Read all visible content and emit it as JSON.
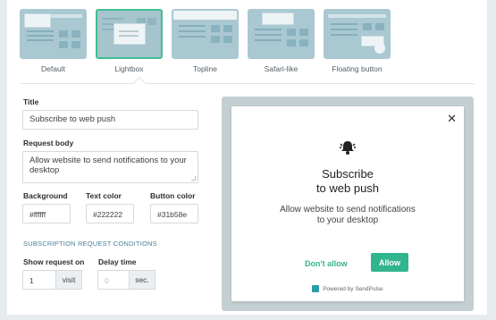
{
  "templates": [
    {
      "label": "Default",
      "active": false
    },
    {
      "label": "Lightbox",
      "active": true
    },
    {
      "label": "Topline",
      "active": false
    },
    {
      "label": "Safari-like",
      "active": false
    },
    {
      "label": "Floating button",
      "active": false
    }
  ],
  "form": {
    "title_label": "Title",
    "title_value": "Subscribe to web push",
    "body_label": "Request body",
    "body_value": "Allow website to send notifications to your desktop",
    "background_label": "Background",
    "background_value": "#ffffff",
    "text_color_label": "Text color",
    "text_color_value": "#222222",
    "button_color_label": "Button color",
    "button_color_value": "#31b58e",
    "conditions_title": "SUBSCRIPTION REQUEST CONDITIONS",
    "show_request_label": "Show request on",
    "show_request_value": "1",
    "show_request_unit": "visit",
    "delay_label": "Delay time",
    "delay_placeholder": "0",
    "delay_unit": "sec."
  },
  "preview": {
    "close_icon": "close-icon",
    "bell_icon": "bell-icon",
    "title_line1": "Subscribe",
    "title_line2": "to web push",
    "body_line1": "Allow website to send notifications",
    "body_line2": "to your desktop",
    "deny_label": "Don't allow",
    "allow_label": "Allow",
    "powered_by": "Powered by SendPulse"
  },
  "colors": {
    "accent": "#31b58e",
    "section_title": "#4b7f93",
    "preview_bg": "#c4cfd4"
  }
}
